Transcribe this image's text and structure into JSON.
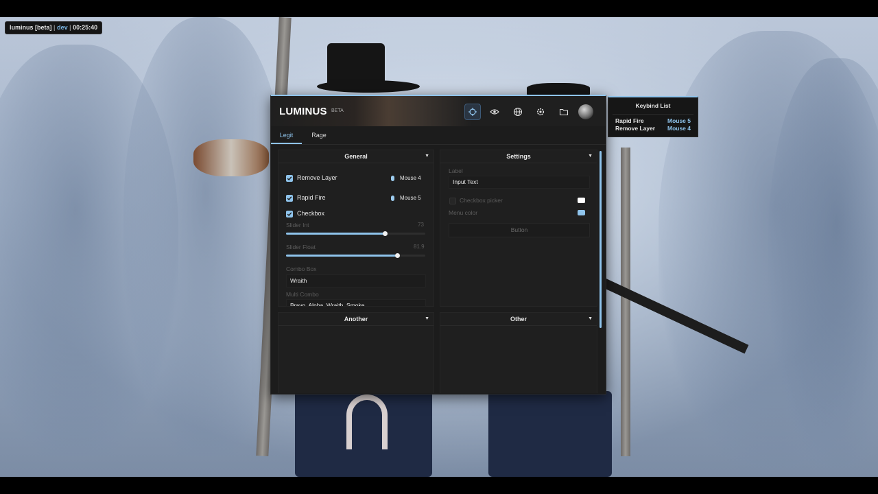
{
  "watermark": {
    "name": "luminus [beta]",
    "sep1": "|",
    "env": "dev",
    "sep2": "|",
    "timer": "00:25:40"
  },
  "menu": {
    "logo": "LUMINUS",
    "badge": "BETA",
    "header_icons": [
      "crosshair-icon",
      "eye-icon",
      "globe-icon",
      "gear-icon",
      "folder-icon",
      "avatar"
    ],
    "active_icon": "crosshair-icon",
    "tabs": [
      {
        "label": "Legit",
        "active": true
      },
      {
        "label": "Rage",
        "active": false
      }
    ],
    "accent_color": "#8fc4ec"
  },
  "general": {
    "title": "General",
    "items": {
      "remove_layer": {
        "label": "Remove Layer",
        "checked": true,
        "key": "Mouse 4"
      },
      "rapid_fire": {
        "label": "Rapid Fire",
        "checked": true,
        "key": "Mouse 5"
      },
      "checkbox": {
        "label": "Checkbox",
        "checked": true
      }
    },
    "slider_int": {
      "label": "Slider Int",
      "value": "73",
      "fraction": 0.71
    },
    "slider_float": {
      "label": "Slider Float",
      "value": "81.9",
      "fraction": 0.8
    },
    "combo": {
      "label": "Combo Box",
      "value": "Wraith"
    },
    "multi_combo": {
      "label": "Multi Combo",
      "value": "Bravo, Alpha, Wraith, Smoke"
    }
  },
  "settings": {
    "title": "Settings",
    "label": "Label",
    "input_value": "Input Text",
    "checkbox_picker": {
      "label": "Checkbox picker",
      "checked": false,
      "color": "#ffffff"
    },
    "menu_color": {
      "label": "Menu color",
      "color": "#8fc4ec"
    },
    "button": "Button"
  },
  "another": {
    "title": "Another"
  },
  "other": {
    "title": "Other"
  },
  "keybinds": {
    "title": "Keybind List",
    "items": [
      {
        "name": "Rapid Fire",
        "key": "Mouse 5"
      },
      {
        "name": "Remove Layer",
        "key": "Mouse 4"
      }
    ]
  }
}
